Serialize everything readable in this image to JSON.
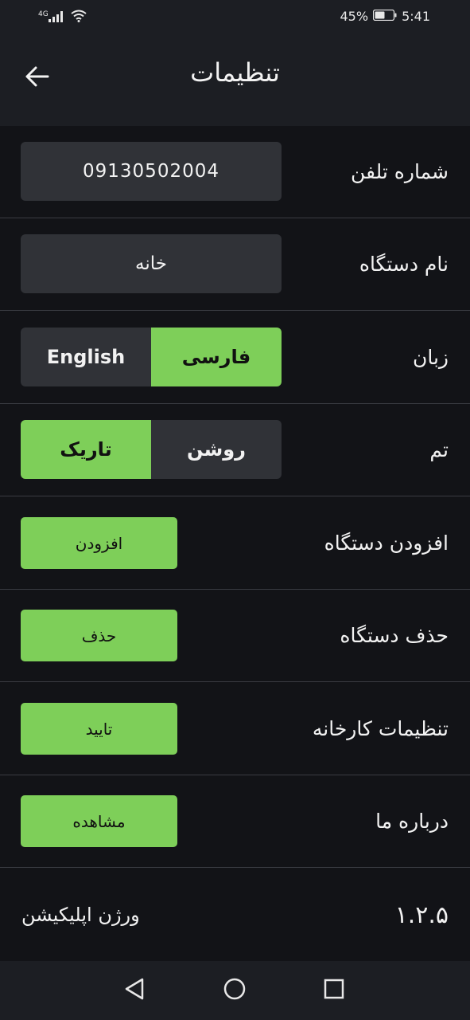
{
  "status_bar": {
    "network_type": "4G",
    "battery_percent": "45%",
    "time": "5:41",
    "icons": [
      "signal-icon",
      "wifi-icon",
      "battery-icon"
    ]
  },
  "header": {
    "title": "تنظیمات",
    "back_icon": "arrow-left-icon"
  },
  "settings": {
    "phone": {
      "label": "شماره تلفن",
      "value": "09130502004"
    },
    "device_name": {
      "label": "نام دستگاه",
      "value": "خانه"
    },
    "language": {
      "label": "زبان",
      "option_english": "English",
      "option_farsi": "فارسی",
      "selected": "فارسی"
    },
    "theme": {
      "label": "تم",
      "option_dark": "تاریک",
      "option_light": "روشن",
      "selected": "تاریک"
    },
    "add_device": {
      "label": "افزودن دستگاه",
      "button": "افزودن"
    },
    "remove_device": {
      "label": "حذف دستگاه",
      "button": "حذف"
    },
    "factory_settings": {
      "label": "تنظیمات کارخانه",
      "button": "تایید"
    },
    "about": {
      "label": "درباره ما",
      "button": "مشاهده"
    },
    "app_version": {
      "label": "ورژن اپلیکیشن",
      "value": "۱.۲.۵"
    }
  },
  "nav_bar": {
    "icons": [
      "back-triangle-icon",
      "home-circle-icon",
      "recents-square-icon"
    ]
  },
  "colors": {
    "background": "#121317",
    "bar": "#1c1e23",
    "field": "#303237",
    "accent": "#7ecf59",
    "divider": "#3a3c42"
  }
}
